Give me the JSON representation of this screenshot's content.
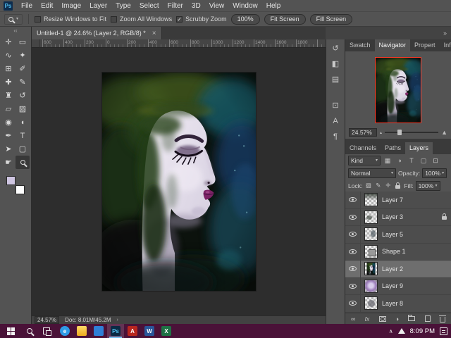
{
  "menu": {
    "logo": "Ps",
    "items": [
      "File",
      "Edit",
      "Image",
      "Layer",
      "Type",
      "Select",
      "Filter",
      "3D",
      "View",
      "Window",
      "Help"
    ]
  },
  "options": {
    "check_glyph": "✓",
    "drop_arrow": "▾",
    "checkboxes": [
      {
        "label": "Resize Windows to Fit",
        "checked": false
      },
      {
        "label": "Zoom All Windows",
        "checked": false
      },
      {
        "label": "Scrubby Zoom",
        "checked": true
      }
    ],
    "buttons": [
      "100%",
      "Fit Screen",
      "Fill Screen"
    ]
  },
  "document": {
    "tab": "Untitled-1 @ 24.6% (Layer 2, RGB/8) *",
    "close": "×"
  },
  "ruler": {
    "ticks": [
      "600",
      "400",
      "200",
      "0",
      "200",
      "400",
      "600",
      "800",
      "1000",
      "1200",
      "1400",
      "1600",
      "1800"
    ]
  },
  "toolbar": {
    "collapse": "‹‹",
    "tools": [
      {
        "name": "move",
        "glyph": "✛"
      },
      {
        "name": "rectangular-marquee",
        "glyph": "▭"
      },
      {
        "name": "lasso",
        "glyph": "∿"
      },
      {
        "name": "quick-selection",
        "glyph": "✦"
      },
      {
        "name": "crop",
        "glyph": "⊞"
      },
      {
        "name": "eyedropper",
        "glyph": "✐"
      },
      {
        "name": "spot-healing-brush",
        "glyph": "✚"
      },
      {
        "name": "brush",
        "glyph": "✎"
      },
      {
        "name": "clone-stamp",
        "glyph": "♜"
      },
      {
        "name": "history-brush",
        "glyph": "↺"
      },
      {
        "name": "eraser",
        "glyph": "▱"
      },
      {
        "name": "gradient",
        "glyph": "▨"
      },
      {
        "name": "blur",
        "glyph": "◉"
      },
      {
        "name": "dodge",
        "glyph": "◖"
      },
      {
        "name": "pen",
        "glyph": "✒"
      },
      {
        "name": "type",
        "glyph": "T"
      },
      {
        "name": "path-selection",
        "glyph": "➤"
      },
      {
        "name": "rectangle-shape",
        "glyph": "▢"
      },
      {
        "name": "hand",
        "glyph": "☛"
      }
    ]
  },
  "right_strip": {
    "collapse": "»",
    "icons": [
      {
        "name": "history-panel",
        "glyph": "↺"
      },
      {
        "name": "adjustments-panel",
        "glyph": "◧"
      },
      {
        "name": "styles-panel",
        "glyph": "▤"
      },
      {
        "name": "clone-source-panel",
        "glyph": "⊡"
      },
      {
        "name": "character-panel",
        "glyph": "A"
      },
      {
        "name": "paragraph-panel",
        "glyph": "¶"
      }
    ]
  },
  "navigator": {
    "tabs": [
      "Swatch",
      "Navigator",
      "Propert",
      "Info"
    ],
    "active_tab": "Navigator",
    "zoom": "24.57%",
    "mountain_small": "▴",
    "mountain_big": "▲"
  },
  "layers": {
    "tabs": [
      "Channels",
      "Paths",
      "Layers"
    ],
    "active_tab": "Layers",
    "filter_label": "Kind",
    "filter_icons": [
      "▦",
      "◑",
      "T",
      "▢",
      "⊡"
    ],
    "blend_mode": "Normal",
    "opacity_label": "Opacity:",
    "opacity": "100%",
    "lock_label": "Lock:",
    "lock_icons": [
      "▨",
      "✎",
      "✛",
      "⊞"
    ],
    "fill_label": "Fill:",
    "fill": "100%",
    "drop_arrow": "▾",
    "fx_label": "fx",
    "link_glyph": "∞",
    "adjustment_glyph": "◑",
    "rows": [
      {
        "name": "Layer 7",
        "selected": false,
        "locked": false
      },
      {
        "name": "Layer 3",
        "selected": false,
        "locked": true
      },
      {
        "name": "Layer 5",
        "selected": false,
        "locked": false
      },
      {
        "name": "Shape 1",
        "selected": false,
        "locked": false
      },
      {
        "name": "Layer 2",
        "selected": true,
        "locked": false
      },
      {
        "name": "Layer 9",
        "selected": false,
        "locked": false
      },
      {
        "name": "Layer 8",
        "selected": false,
        "locked": false
      }
    ]
  },
  "status": {
    "zoom": "24.57%",
    "doc": "Doc: 8.01M/45.2M",
    "arrow": "›"
  },
  "taskbar": {
    "time": "8:09 PM",
    "apps": [
      {
        "name": "edge",
        "label": "e",
        "style": "background:#2e9ae6;color:#fff;border-radius:50%"
      },
      {
        "name": "file-explorer",
        "label": "",
        "style": "background:linear-gradient(180deg,#ffd967,#edab1f)"
      },
      {
        "name": "store",
        "label": "",
        "style": "background:#2f7fd6"
      },
      {
        "name": "photoshop",
        "label": "Ps",
        "style": "background:#0b2a44;color:#53c1f0",
        "active": true
      },
      {
        "name": "acrobat",
        "label": "A",
        "style": "background:#b8271f;color:#fff"
      },
      {
        "name": "word",
        "label": "W",
        "style": "background:#2a5699;color:#fff"
      },
      {
        "name": "excel",
        "label": "X",
        "style": "background:#1f7145;color:#fff"
      }
    ]
  },
  "colors": {
    "panel_bg": "#535353",
    "canvas_bg": "#2d2d2d",
    "taskbar_bg": "#4a1238",
    "selected_layer_bg": "#6e6e6e",
    "navigator_frame": "#ff3a28",
    "foreground_swatch": "#cfc6e2",
    "background_swatch": "#ffffff"
  }
}
